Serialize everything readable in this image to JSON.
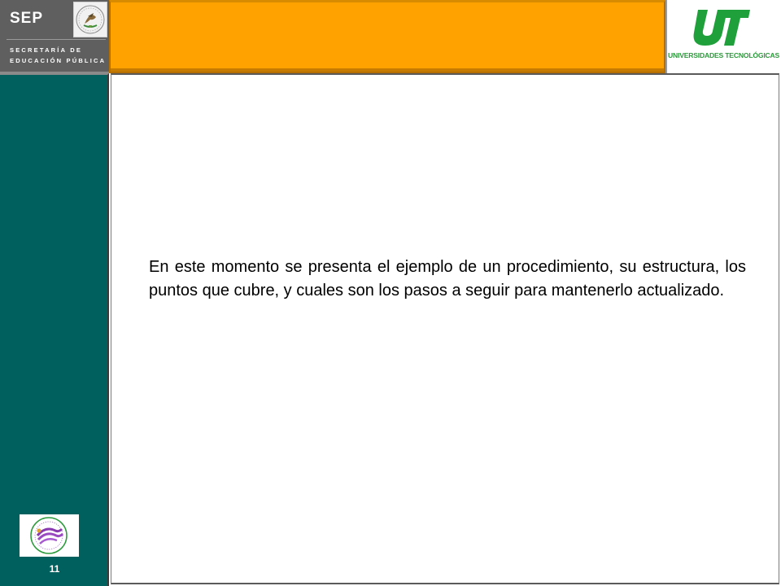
{
  "header": {
    "left_logo": {
      "title": "SEP",
      "subtitle_line1": "SECRETARÍA DE",
      "subtitle_line2": "EDUCACIÓN PÚBLICA"
    },
    "right_logo": {
      "mark": "UT",
      "caption": "UNIVERSIDADES TECNOLÓGICAS"
    }
  },
  "slide": {
    "body": "En este momento se presenta el ejemplo de un procedimiento, su estructura, los puntos que cubre, y cuales son los pasos a seguir para mantenerlo actualizado.",
    "page_number": "11"
  },
  "colors": {
    "orange_band": "#ffa200",
    "sidebar_teal": "#00605e",
    "header_gray": "#5f5f5f",
    "ut_green": "#2a9a3a"
  },
  "icons": [
    "mexican-eagle-emblem-icon",
    "ut-logo-icon",
    "certification-seal-icon"
  ]
}
